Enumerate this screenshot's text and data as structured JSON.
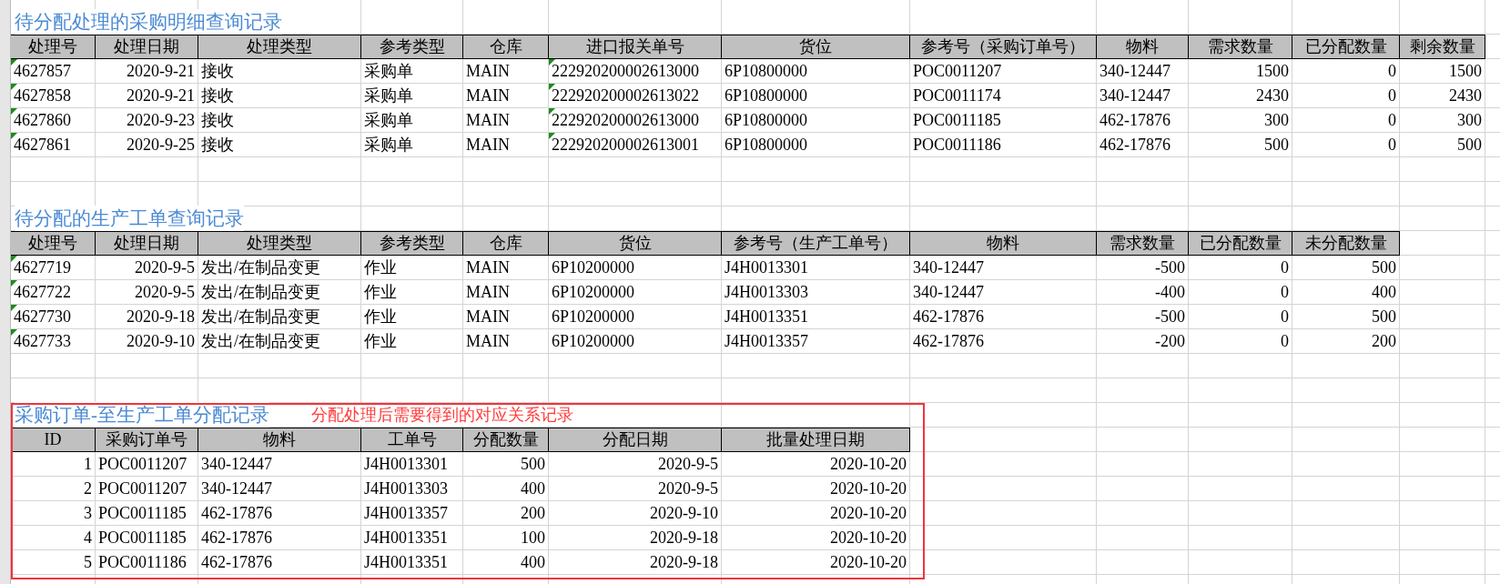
{
  "sheet": {
    "tables": [
      {
        "title": "待分配处理的采购明细查询记录",
        "columns": [
          {
            "label": "处理号",
            "kind": "text",
            "marker": true
          },
          {
            "label": "处理日期",
            "kind": "number",
            "marker": false
          },
          {
            "label": "处理类型",
            "kind": "text",
            "marker": false
          },
          {
            "label": "参考类型",
            "kind": "text",
            "marker": false
          },
          {
            "label": "仓库",
            "kind": "text",
            "marker": false
          },
          {
            "label": "进口报关单号",
            "kind": "text",
            "marker": true
          },
          {
            "label": "货位",
            "kind": "text",
            "marker": false
          },
          {
            "label": "参考号（采购订单号）",
            "kind": "text",
            "marker": false
          },
          {
            "label": "物料",
            "kind": "text",
            "marker": false
          },
          {
            "label": "需求数量",
            "kind": "number",
            "marker": false
          },
          {
            "label": "已分配数量",
            "kind": "number",
            "marker": false
          },
          {
            "label": "剩余数量",
            "kind": "number",
            "marker": false
          }
        ],
        "rows": [
          [
            "4627857",
            "2020-9-21",
            "接收",
            "采购单",
            "MAIN",
            "222920200002613000",
            "6P10800000",
            "POC0011207",
            "340-12447",
            "1500",
            "0",
            "1500"
          ],
          [
            "4627858",
            "2020-9-21",
            "接收",
            "采购单",
            "MAIN",
            "222920200002613022",
            "6P10800000",
            "POC0011174",
            "340-12447",
            "2430",
            "0",
            "2430"
          ],
          [
            "4627860",
            "2020-9-23",
            "接收",
            "采购单",
            "MAIN",
            "222920200002613000",
            "6P10800000",
            "POC0011185",
            "462-17876",
            "300",
            "0",
            "300"
          ],
          [
            "4627861",
            "2020-9-25",
            "接收",
            "采购单",
            "MAIN",
            "222920200002613001",
            "6P10800000",
            "POC0011186",
            "462-17876",
            "500",
            "0",
            "500"
          ]
        ]
      },
      {
        "title": "待分配的生产工单查询记录",
        "columns": [
          {
            "label": "处理号",
            "kind": "text",
            "marker": true
          },
          {
            "label": "处理日期",
            "kind": "number",
            "marker": false
          },
          {
            "label": "处理类型",
            "kind": "text",
            "marker": false
          },
          {
            "label": "参考类型",
            "kind": "text",
            "marker": false
          },
          {
            "label": "仓库",
            "kind": "text",
            "marker": false
          },
          {
            "label": "货位",
            "kind": "text",
            "marker": false
          },
          {
            "label": "参考号（生产工单号）",
            "kind": "text",
            "marker": false
          },
          {
            "label": "物料",
            "kind": "text",
            "marker": false
          },
          {
            "label": "需求数量",
            "kind": "number",
            "marker": false
          },
          {
            "label": "已分配数量",
            "kind": "number",
            "marker": false
          },
          {
            "label": "未分配数量",
            "kind": "number",
            "marker": false
          }
        ],
        "rows": [
          [
            "4627719",
            "2020-9-5",
            "发出/在制品变更",
            "作业",
            "MAIN",
            "6P10200000",
            "J4H0013301",
            "340-12447",
            "-500",
            "0",
            "500"
          ],
          [
            "4627722",
            "2020-9-5",
            "发出/在制品变更",
            "作业",
            "MAIN",
            "6P10200000",
            "J4H0013303",
            "340-12447",
            "-400",
            "0",
            "400"
          ],
          [
            "4627730",
            "2020-9-18",
            "发出/在制品变更",
            "作业",
            "MAIN",
            "6P10200000",
            "J4H0013351",
            "462-17876",
            "-500",
            "0",
            "500"
          ],
          [
            "4627733",
            "2020-9-10",
            "发出/在制品变更",
            "作业",
            "MAIN",
            "6P10200000",
            "J4H0013357",
            "462-17876",
            "-200",
            "0",
            "200"
          ]
        ]
      },
      {
        "title": "采购订单-至生产工单分配记录",
        "note": "分配处理后需要得到的对应关系记录",
        "highlighted": true,
        "columns": [
          {
            "label": "ID",
            "kind": "number",
            "marker": false
          },
          {
            "label": "采购订单号",
            "kind": "text",
            "marker": false
          },
          {
            "label": "物料",
            "kind": "text",
            "marker": false
          },
          {
            "label": "工单号",
            "kind": "text",
            "marker": false
          },
          {
            "label": "分配数量",
            "kind": "number",
            "marker": false
          },
          {
            "label": "分配日期",
            "kind": "number",
            "marker": false
          },
          {
            "label": "批量处理日期",
            "kind": "number",
            "marker": false
          }
        ],
        "rows": [
          [
            "1",
            "POC0011207",
            "340-12447",
            "J4H0013301",
            "500",
            "2020-9-5",
            "2020-10-20"
          ],
          [
            "2",
            "POC0011207",
            "340-12447",
            "J4H0013303",
            "400",
            "2020-9-5",
            "2020-10-20"
          ],
          [
            "3",
            "POC0011185",
            "462-17876",
            "J4H0013357",
            "200",
            "2020-9-10",
            "2020-10-20"
          ],
          [
            "4",
            "POC0011185",
            "462-17876",
            "J4H0013351",
            "100",
            "2020-9-18",
            "2020-10-20"
          ],
          [
            "5",
            "POC0011186",
            "462-17876",
            "J4H0013351",
            "400",
            "2020-9-18",
            "2020-10-20"
          ]
        ]
      }
    ]
  }
}
